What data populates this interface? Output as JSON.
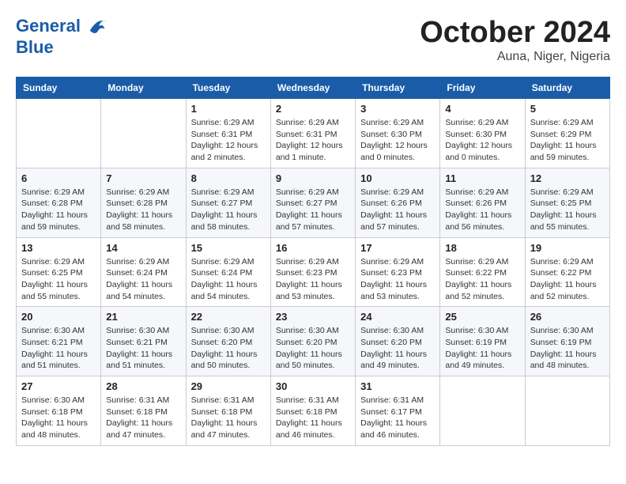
{
  "header": {
    "logo_line1": "General",
    "logo_line2": "Blue",
    "month": "October 2024",
    "location": "Auna, Niger, Nigeria"
  },
  "weekdays": [
    "Sunday",
    "Monday",
    "Tuesday",
    "Wednesday",
    "Thursday",
    "Friday",
    "Saturday"
  ],
  "weeks": [
    [
      {
        "day": "",
        "info": ""
      },
      {
        "day": "",
        "info": ""
      },
      {
        "day": "1",
        "info": "Sunrise: 6:29 AM\nSunset: 6:31 PM\nDaylight: 12 hours\nand 2 minutes."
      },
      {
        "day": "2",
        "info": "Sunrise: 6:29 AM\nSunset: 6:31 PM\nDaylight: 12 hours\nand 1 minute."
      },
      {
        "day": "3",
        "info": "Sunrise: 6:29 AM\nSunset: 6:30 PM\nDaylight: 12 hours\nand 0 minutes."
      },
      {
        "day": "4",
        "info": "Sunrise: 6:29 AM\nSunset: 6:30 PM\nDaylight: 12 hours\nand 0 minutes."
      },
      {
        "day": "5",
        "info": "Sunrise: 6:29 AM\nSunset: 6:29 PM\nDaylight: 11 hours\nand 59 minutes."
      }
    ],
    [
      {
        "day": "6",
        "info": "Sunrise: 6:29 AM\nSunset: 6:28 PM\nDaylight: 11 hours\nand 59 minutes."
      },
      {
        "day": "7",
        "info": "Sunrise: 6:29 AM\nSunset: 6:28 PM\nDaylight: 11 hours\nand 58 minutes."
      },
      {
        "day": "8",
        "info": "Sunrise: 6:29 AM\nSunset: 6:27 PM\nDaylight: 11 hours\nand 58 minutes."
      },
      {
        "day": "9",
        "info": "Sunrise: 6:29 AM\nSunset: 6:27 PM\nDaylight: 11 hours\nand 57 minutes."
      },
      {
        "day": "10",
        "info": "Sunrise: 6:29 AM\nSunset: 6:26 PM\nDaylight: 11 hours\nand 57 minutes."
      },
      {
        "day": "11",
        "info": "Sunrise: 6:29 AM\nSunset: 6:26 PM\nDaylight: 11 hours\nand 56 minutes."
      },
      {
        "day": "12",
        "info": "Sunrise: 6:29 AM\nSunset: 6:25 PM\nDaylight: 11 hours\nand 55 minutes."
      }
    ],
    [
      {
        "day": "13",
        "info": "Sunrise: 6:29 AM\nSunset: 6:25 PM\nDaylight: 11 hours\nand 55 minutes."
      },
      {
        "day": "14",
        "info": "Sunrise: 6:29 AM\nSunset: 6:24 PM\nDaylight: 11 hours\nand 54 minutes."
      },
      {
        "day": "15",
        "info": "Sunrise: 6:29 AM\nSunset: 6:24 PM\nDaylight: 11 hours\nand 54 minutes."
      },
      {
        "day": "16",
        "info": "Sunrise: 6:29 AM\nSunset: 6:23 PM\nDaylight: 11 hours\nand 53 minutes."
      },
      {
        "day": "17",
        "info": "Sunrise: 6:29 AM\nSunset: 6:23 PM\nDaylight: 11 hours\nand 53 minutes."
      },
      {
        "day": "18",
        "info": "Sunrise: 6:29 AM\nSunset: 6:22 PM\nDaylight: 11 hours\nand 52 minutes."
      },
      {
        "day": "19",
        "info": "Sunrise: 6:29 AM\nSunset: 6:22 PM\nDaylight: 11 hours\nand 52 minutes."
      }
    ],
    [
      {
        "day": "20",
        "info": "Sunrise: 6:30 AM\nSunset: 6:21 PM\nDaylight: 11 hours\nand 51 minutes."
      },
      {
        "day": "21",
        "info": "Sunrise: 6:30 AM\nSunset: 6:21 PM\nDaylight: 11 hours\nand 51 minutes."
      },
      {
        "day": "22",
        "info": "Sunrise: 6:30 AM\nSunset: 6:20 PM\nDaylight: 11 hours\nand 50 minutes."
      },
      {
        "day": "23",
        "info": "Sunrise: 6:30 AM\nSunset: 6:20 PM\nDaylight: 11 hours\nand 50 minutes."
      },
      {
        "day": "24",
        "info": "Sunrise: 6:30 AM\nSunset: 6:20 PM\nDaylight: 11 hours\nand 49 minutes."
      },
      {
        "day": "25",
        "info": "Sunrise: 6:30 AM\nSunset: 6:19 PM\nDaylight: 11 hours\nand 49 minutes."
      },
      {
        "day": "26",
        "info": "Sunrise: 6:30 AM\nSunset: 6:19 PM\nDaylight: 11 hours\nand 48 minutes."
      }
    ],
    [
      {
        "day": "27",
        "info": "Sunrise: 6:30 AM\nSunset: 6:18 PM\nDaylight: 11 hours\nand 48 minutes."
      },
      {
        "day": "28",
        "info": "Sunrise: 6:31 AM\nSunset: 6:18 PM\nDaylight: 11 hours\nand 47 minutes."
      },
      {
        "day": "29",
        "info": "Sunrise: 6:31 AM\nSunset: 6:18 PM\nDaylight: 11 hours\nand 47 minutes."
      },
      {
        "day": "30",
        "info": "Sunrise: 6:31 AM\nSunset: 6:18 PM\nDaylight: 11 hours\nand 46 minutes."
      },
      {
        "day": "31",
        "info": "Sunrise: 6:31 AM\nSunset: 6:17 PM\nDaylight: 11 hours\nand 46 minutes."
      },
      {
        "day": "",
        "info": ""
      },
      {
        "day": "",
        "info": ""
      }
    ]
  ]
}
